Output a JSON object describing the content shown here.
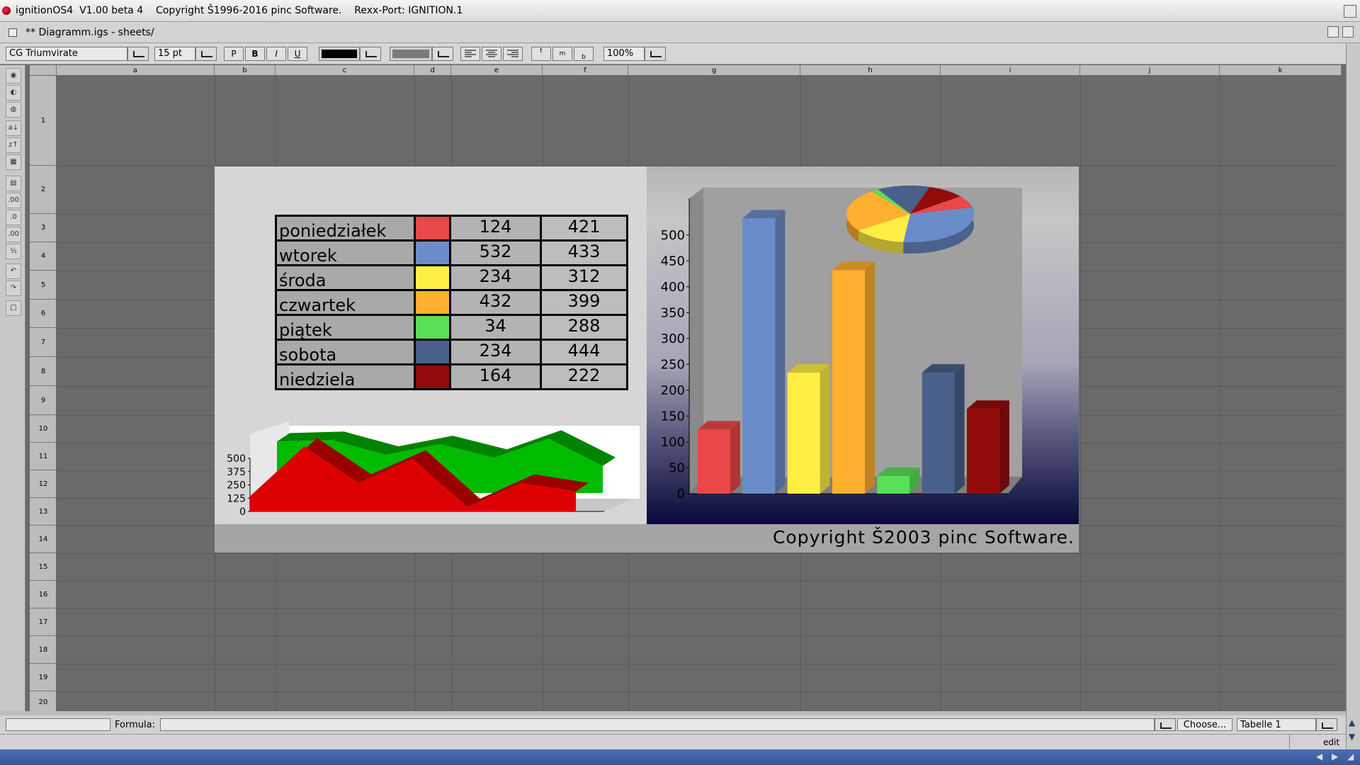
{
  "titlebar": {
    "text": "ignitionOS4  V1.00 beta 4    Copyright Š1996-2016 pinc Software.    Rexx-Port: IGNITION.1"
  },
  "window": {
    "title": "** Diagramm.igs  -  sheets/"
  },
  "toolbar": {
    "font_name": "CG Triumvirate",
    "font_size": "15 pt",
    "style_buttons": [
      "P",
      "B",
      "I",
      "U"
    ],
    "text_color": "#000000",
    "fill_color": "#7a7a7a",
    "align_buttons": [
      "align-left",
      "align-center",
      "align-right"
    ],
    "valign_buttons": [
      "t",
      "m",
      "b"
    ],
    "zoom": "100%"
  },
  "sheet": {
    "columns": [
      "a",
      "b",
      "c",
      "d",
      "e",
      "f",
      "g",
      "h",
      "i",
      "j",
      "k"
    ],
    "rows": [
      "1",
      "2",
      "3",
      "4",
      "5",
      "6",
      "7",
      "8",
      "9",
      "10",
      "11",
      "12",
      "13",
      "14",
      "15",
      "16",
      "17",
      "18",
      "19",
      "20"
    ]
  },
  "picture": {
    "table": [
      {
        "day": "poniedziałek",
        "color": "#e84848",
        "a": "124",
        "b": "421"
      },
      {
        "day": "wtorek",
        "color": "#6a8cc8",
        "a": "532",
        "b": "433"
      },
      {
        "day": "środa",
        "color": "#ffee44",
        "a": "234",
        "b": "312"
      },
      {
        "day": "czwartek",
        "color": "#ffb030",
        "a": "432",
        "b": "399"
      },
      {
        "day": "piątek",
        "color": "#58e058",
        "a": "34",
        "b": "288"
      },
      {
        "day": "sobota",
        "color": "#48608a",
        "a": "234",
        "b": "444"
      },
      {
        "day": "niedziela",
        "color": "#920c0c",
        "a": "164",
        "b": "222"
      }
    ],
    "copyright": "Copyright Š2003 pinc Software."
  },
  "chart_data": [
    {
      "type": "bar",
      "categories": [
        "poniedziałek",
        "wtorek",
        "środa",
        "czwartek",
        "piątek",
        "sobota",
        "niedziela"
      ],
      "values": [
        124,
        532,
        234,
        432,
        34,
        234,
        164
      ],
      "colors": [
        "#e84848",
        "#6a8cc8",
        "#ffee44",
        "#ffb030",
        "#58e058",
        "#48608a",
        "#920c0c"
      ],
      "yticks": [
        "500",
        "450",
        "400",
        "350",
        "300",
        "250",
        "200",
        "150",
        "100",
        "50",
        "0"
      ],
      "ylim": [
        0,
        550
      ]
    },
    {
      "type": "pie",
      "categories": [
        "poniedziałek",
        "wtorek",
        "środa",
        "czwartek",
        "piątek",
        "sobota",
        "niedziela"
      ],
      "values": [
        124,
        532,
        234,
        432,
        34,
        234,
        164
      ]
    },
    {
      "type": "area",
      "series": [
        {
          "color": "#00bb00",
          "values": [
            421,
            433,
            312,
            399,
            288,
            444,
            222
          ]
        },
        {
          "color": "#dd0000",
          "values": [
            124,
            532,
            234,
            432,
            34,
            234,
            164
          ]
        }
      ],
      "yticks": [
        "500",
        "375",
        "250",
        "125",
        "0"
      ],
      "ylim": [
        0,
        500
      ]
    }
  ],
  "formula": {
    "label": "Formula:",
    "choose_label": "Choose...",
    "table_name": "Tabelle 1",
    "value": ""
  },
  "status": {
    "mode": "edit"
  }
}
